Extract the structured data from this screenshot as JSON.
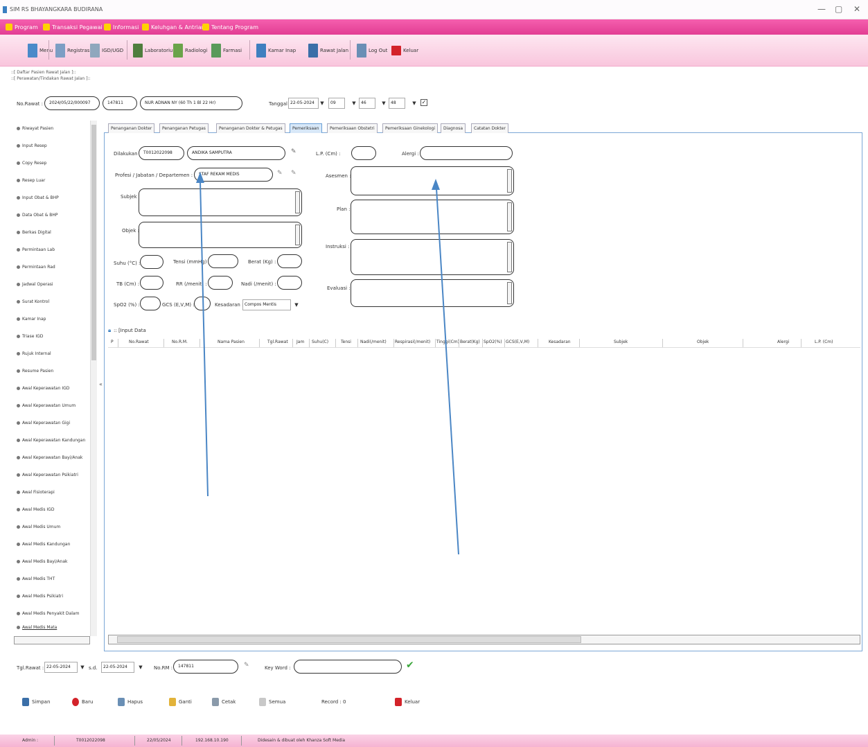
{
  "window": {
    "title": "SIM RS BHAYANGKARA BUDIRANA",
    "min": "—",
    "max": "▢",
    "close": "✕"
  },
  "menu": [
    "Program",
    "Transaksi Pegawai",
    "Informasi",
    "Keluhgan & Antrian",
    "Tentang Program"
  ],
  "toolbar": [
    "Menu",
    "Registrasi",
    "IGD/UGD",
    "Laboratorium",
    "Radiologi",
    "Farmasi",
    "Kamar Inap",
    "Rawat Jalan",
    "Log Out",
    "Keluar"
  ],
  "breadcrumb": {
    "line1": "::[ Daftar Pasien Rawat Jalan ]::",
    "line2": "::[ Perawatan/Tindakan Rawat Jalan ]::"
  },
  "header": {
    "no_rawat_label": "No.Rawat :",
    "no_rawat": "2024/05/22/000097",
    "no_rm": "147811",
    "patient": "NUR ADNAN NY (60 Th 1 Bl 22 Hr)",
    "tanggal_label": "Tanggal :",
    "tanggal": "22-05-2024",
    "jam": "09",
    "menit": "46",
    "detik": "48",
    "check": "✓"
  },
  "sidebar": [
    "Riwayat Pasien",
    "Input Resep",
    "Copy Resep",
    "Resep Luar",
    "Input Obat & BHP",
    "Data Obat & BHP",
    "Berkas Digital",
    "Permintaan Lab",
    "Permintaan Rad",
    "Jadwal Operasi",
    "Surat Kontrol",
    "Kamar Inap",
    "Triase IGD",
    "Rujuk Internal",
    "Resume Pasien",
    "Awal Keperawatan IGD",
    "Awal Keperawatan Umum",
    "Awal Keperawatan Gigi",
    "Awal Keperawatan Kandungan",
    "Awal Keperawatan Bayi/Anak",
    "Awal Keperawatan Psikiatri",
    "Awal Fisioterapi",
    "Awal Medis IGD",
    "Awal Medis Umum",
    "Awal Medis Kandungan",
    "Awal Medis Bayi/Anak",
    "Awal Medis THT",
    "Awal Medis Psikiatri",
    "Awal Medis Penyakit Dalam",
    "Awal Medis Mata"
  ],
  "tabs": [
    "Penanganan Dokter",
    "Penanganan Petugas",
    "Penanganan Dokter & Petugas",
    "Pemeriksaan",
    "Pemeriksaan Obstetri",
    "Pemeriksaan Ginekologi",
    "Diagnosa",
    "Catatan Dokter"
  ],
  "form": {
    "dilakukan_label": "Dilakukan :",
    "dilakukan_id": "T0012022098",
    "dilakukan_name": "ANDIKA SAMPUTRA",
    "profesi_label": "Profesi / Jabatan / Departemen :",
    "profesi": "STAF REKAM MEDIS",
    "subjek_label": "Subjek :",
    "objek_label": "Objek :",
    "suhu_label": "Suhu (°C) :",
    "tensi_label": "Tensi (mmHg) :",
    "berat_label": "Berat (Kg) :",
    "tb_label": "TB (Cm) :",
    "rr_label": "RR (/menit) :",
    "nadi_label": "Nadi (/menit) :",
    "spo2_label": "SpO2 (%) :",
    "gcs_label": "GCS (E,V,M) :",
    "kesadaran_label": "Kesadaran :",
    "kesadaran": "Compos Mentis",
    "lp_label": "L.P. (Cm) :",
    "alergi_label": "Alergi :",
    "asesmen_label": "Asesmen :",
    "plan_label": "Plan :",
    "instruksi_label": "Instruksi :",
    "evaluasi_label": "Evaluasi :",
    "input_data": ":: [Input Data"
  },
  "grid_columns": [
    "P",
    "No.Rawat",
    "No.R.M.",
    "Nama Pasien",
    "Tgl.Rawat",
    "Jam",
    "Suhu(C)",
    "Tensi",
    "Nadi(/menit)",
    "Respirasi(/menit)",
    "Tinggi(Cm)",
    "Berat(Kg)",
    "SpO2(%)",
    "GCS(E,V,M)",
    "Kesadaran",
    "Subjek",
    "Objek",
    "Alergi",
    "L.P. (Cm)"
  ],
  "filter": {
    "tgl_label": "Tgl.Rawat :",
    "tgl_from": "22-05-2024",
    "sd_label": "s.d.",
    "tgl_to": "22-05-2024",
    "norm_label": "No.RM :",
    "norm": "147811",
    "key_label": "Key Word :",
    "key": ""
  },
  "bottom_buttons": [
    "Simpan",
    "Baru",
    "Hapus",
    "Ganti",
    "Cetak",
    "Semua",
    "Record : 0",
    "Keluar"
  ],
  "status": [
    "Admin :",
    "T0012022098",
    "22/05/2024",
    "192.168.10.190",
    "Didesain & dibuat oleh Khanza Soft Media"
  ],
  "colors": {
    "menubar": "#e23d93",
    "toolbar": "#f9c6dd",
    "tab_active": "#d8e8f8",
    "arrow": "#4a86c5",
    "ok": "#3aa63a"
  }
}
